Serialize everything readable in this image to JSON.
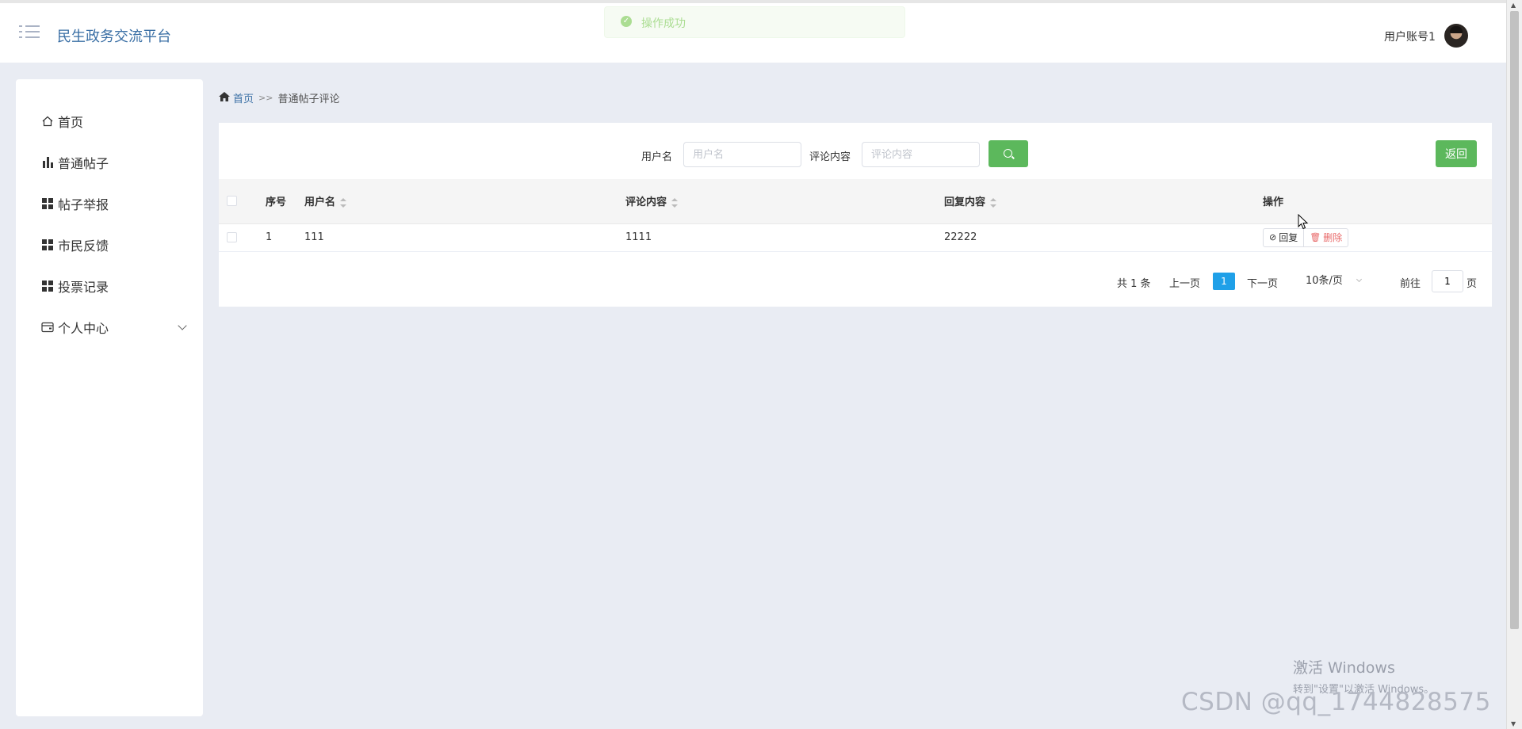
{
  "header": {
    "brand": "民生政务交流平台",
    "account": "用户账号1",
    "toast": "操作成功"
  },
  "breadcrumb": {
    "home": "首页",
    "separator": ">>",
    "current": "普通帖子评论"
  },
  "sidebar": {
    "items": [
      {
        "label": "首页",
        "icon": "home-icon"
      },
      {
        "label": "普通帖子",
        "icon": "bar-chart-icon"
      },
      {
        "label": "帖子举报",
        "icon": "grid-icon"
      },
      {
        "label": "市民反馈",
        "icon": "grid-icon"
      },
      {
        "label": "投票记录",
        "icon": "grid-icon"
      },
      {
        "label": "个人中心",
        "icon": "wallet-icon"
      }
    ]
  },
  "search": {
    "username_label": "用户名",
    "username_placeholder": "用户名",
    "content_label": "评论内容",
    "content_placeholder": "评论内容",
    "back_label": "返回"
  },
  "table": {
    "columns": [
      "序号",
      "用户名",
      "评论内容",
      "回复内容",
      "操作"
    ],
    "rows": [
      {
        "index": "1",
        "username": "111",
        "comment": "1111",
        "reply": "22222"
      }
    ],
    "reply_label": "回复",
    "delete_label": "删除"
  },
  "pagination": {
    "total": "共 1 条",
    "prev": "上一页",
    "current_page": "1",
    "next": "下一页",
    "page_size": "10条/页",
    "goto_label": "前往",
    "goto_value": "1",
    "page_suffix": "页"
  },
  "watermarks": {
    "windows_title": "激活 Windows",
    "windows_sub": "转到\"设置\"以激活 Windows。",
    "csdn": "CSDN @qq_1744828575"
  },
  "colors": {
    "accent_green": "#5cb85c",
    "brand_blue": "#3a6fa5",
    "page_active": "#1fa0e8",
    "delete_red": "#e86a6a"
  }
}
